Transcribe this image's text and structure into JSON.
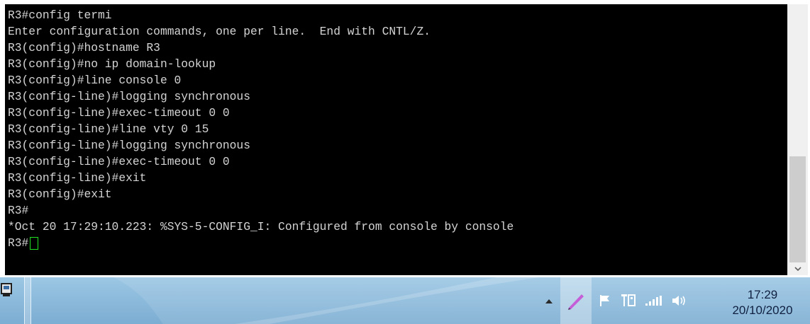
{
  "terminal": {
    "lines": [
      "R3#config termi",
      "Enter configuration commands, one per line.  End with CNTL/Z.",
      "R3(config)#hostname R3",
      "R3(config)#no ip domain-lookup",
      "R3(config)#line console 0",
      "R3(config-line)#logging synchronous",
      "R3(config-line)#exec-timeout 0 0",
      "R3(config-line)#line vty 0 15",
      "R3(config-line)#logging synchronous",
      "R3(config-line)#exec-timeout 0 0",
      "R3(config-line)#exit",
      "R3(config)#exit",
      "R3#",
      "*Oct 20 17:29:10.223: %SYS-5-CONFIG_I: Configured from console by console"
    ],
    "prompt": "R3#",
    "text_color": "#d4d4d4",
    "background": "#000000",
    "cursor_color": "#22e022"
  },
  "scrollbar": {
    "down_icon": "chevron-down-icon"
  },
  "taskbar": {
    "tray_icons": [
      "show-hidden-icons-arrow-icon",
      "pen-icon",
      "action-center-flag-icon",
      "network-adapter-icon",
      "signal-strength-icon",
      "volume-icon"
    ],
    "clock": {
      "time": "17:29",
      "date": "20/10/2020"
    }
  }
}
